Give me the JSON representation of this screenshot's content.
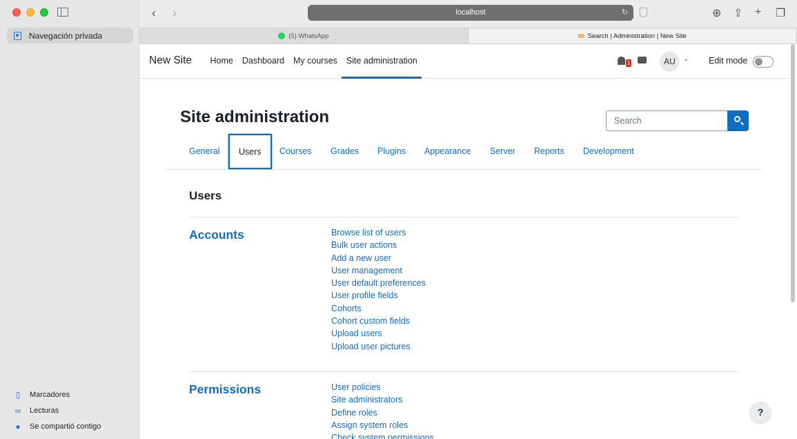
{
  "browser": {
    "sidebar": {
      "private_label": "Navegación privada",
      "bottom_items": [
        {
          "label": "Marcadores",
          "icon": "bookmark-icon"
        },
        {
          "label": "Lecturas",
          "icon": "reading-list-icon"
        },
        {
          "label": "Se compartió contigo",
          "icon": "shared-with-you-icon"
        }
      ]
    },
    "address": "localhost",
    "tabs": [
      {
        "label": "(5) WhatsApp",
        "icon": "whatsapp-icon",
        "active": false
      },
      {
        "label": "Search | Administration | New Site",
        "icon": "moodle-icon",
        "active": true
      }
    ]
  },
  "site": {
    "brand": "New Site",
    "nav": [
      {
        "label": "Home"
      },
      {
        "label": "Dashboard"
      },
      {
        "label": "My courses"
      },
      {
        "label": "Site administration",
        "current": true
      }
    ],
    "notifications_count": "1",
    "avatar_initials": "AU",
    "edit_mode_label": "Edit mode",
    "edit_mode_on": false
  },
  "page": {
    "title": "Site administration",
    "search_placeholder": "Search",
    "tabs": [
      "General",
      "Users",
      "Courses",
      "Grades",
      "Plugins",
      "Appearance",
      "Server",
      "Reports",
      "Development"
    ],
    "active_tab": "Users",
    "section_heading": "Users",
    "categories": [
      {
        "title": "Accounts",
        "links": [
          "Browse list of users",
          "Bulk user actions",
          "Add a new user",
          "User management",
          "User default preferences",
          "User profile fields",
          "Cohorts",
          "Cohort custom fields",
          "Upload users",
          "Upload user pictures"
        ]
      },
      {
        "title": "Permissions",
        "links": [
          "User policies",
          "Site administrators",
          "Define roles",
          "Assign system roles",
          "Check system permissions"
        ]
      }
    ],
    "help_label": "?"
  },
  "colors": {
    "accent": "#0f6cbf",
    "text": "#1d2125",
    "badge": "#ca3120"
  }
}
